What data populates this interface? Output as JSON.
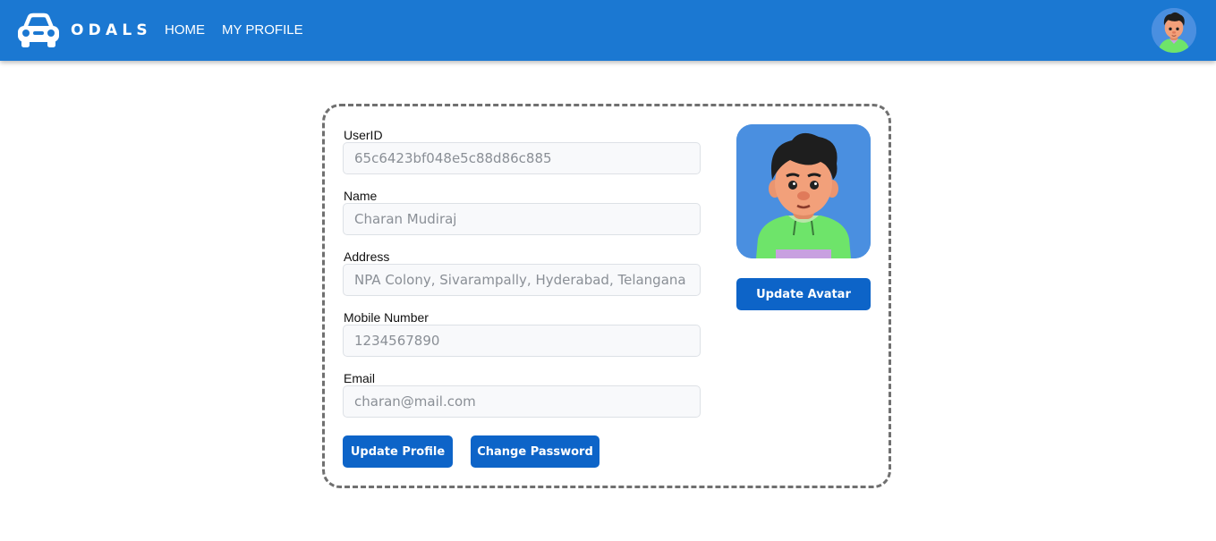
{
  "header": {
    "brand": "ODALS",
    "nav": [
      {
        "label": "HOME"
      },
      {
        "label": "MY PROFILE"
      }
    ]
  },
  "profile": {
    "fields": [
      {
        "label": "UserID",
        "value": "65c6423bf048e5c88d86c885"
      },
      {
        "label": "Name",
        "value": "Charan Mudiraj"
      },
      {
        "label": "Address",
        "value": "NPA Colony, Sivarampally, Hyderabad, Telangana"
      },
      {
        "label": "Mobile Number",
        "value": "1234567890"
      },
      {
        "label": "Email",
        "value": "charan@mail.com"
      }
    ],
    "update_profile_label": "Update Profile",
    "change_password_label": "Change Password",
    "update_avatar_label": "Update Avatar"
  },
  "colors": {
    "header_bg": "#1b78d2",
    "button_bg": "#0d64c8",
    "avatar_bg": "#4a8fe0",
    "card_border": "#707070"
  }
}
